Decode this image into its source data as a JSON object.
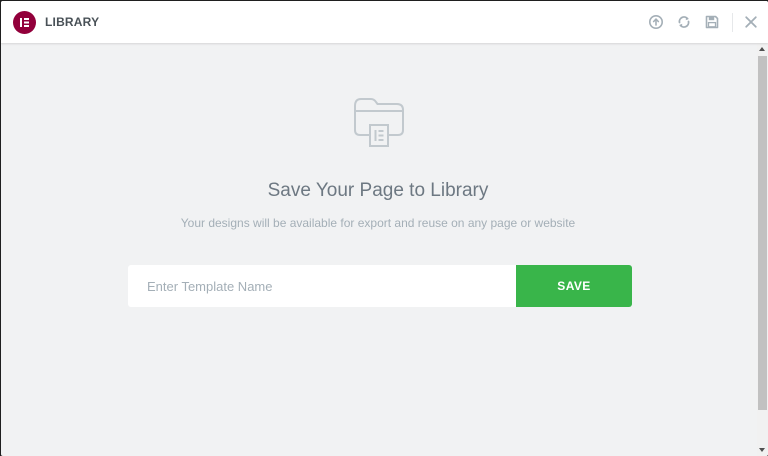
{
  "header": {
    "title": "LIBRARY",
    "logo_icon": "elementor-logo-icon",
    "icons": [
      "info-icon",
      "sync-icon",
      "save-icon",
      "close-icon"
    ]
  },
  "main": {
    "icon": "folder-icon",
    "heading": "Save Your Page to Library",
    "subheading": "Your designs will be available for export and reuse on any page or website",
    "input": {
      "value": "",
      "placeholder": "Enter Template Name"
    },
    "save_label": "SAVE"
  },
  "colors": {
    "brand": "#92003b",
    "save_button": "#39b54a",
    "background": "#f1f2f3",
    "heading": "#6d7882",
    "muted": "#a4afb7"
  }
}
